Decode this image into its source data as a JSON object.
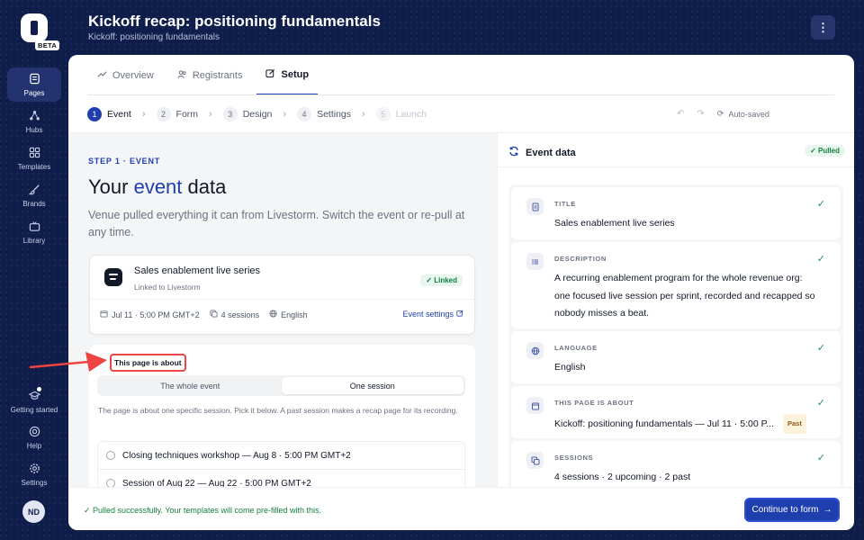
{
  "brand": {
    "beta": "BETA"
  },
  "rail": {
    "items": [
      {
        "label": "Pages",
        "icon": "pages-icon"
      },
      {
        "label": "Hubs",
        "icon": "hubs-icon"
      },
      {
        "label": "Templates",
        "icon": "templates-icon"
      },
      {
        "label": "Brands",
        "icon": "brush-icon"
      },
      {
        "label": "Library",
        "icon": "tv-icon"
      }
    ],
    "bottom": [
      {
        "label": "Getting started",
        "icon": "graduation-cap-icon"
      },
      {
        "label": "Help",
        "icon": "lifebuoy-icon"
      },
      {
        "label": "Settings",
        "icon": "gear-icon"
      }
    ],
    "avatar": "ND"
  },
  "header": {
    "title": "Kickoff recap: positioning fundamentals",
    "subtitle": "Kickoff: positioning fundamentals"
  },
  "tabs": [
    "Overview",
    "Registrants",
    "Setup"
  ],
  "steps": [
    {
      "num": "1",
      "label": "Event"
    },
    {
      "num": "2",
      "label": "Form"
    },
    {
      "num": "3",
      "label": "Design"
    },
    {
      "num": "4",
      "label": "Settings"
    },
    {
      "num": "5",
      "label": "Launch"
    }
  ],
  "autosaved": "Auto-saved",
  "left": {
    "eyebrow": "STEP 1 · EVENT",
    "headline_pre": "Your ",
    "headline_accent": "event",
    "headline_post": " data",
    "lead": "Venue pulled everything it can from Livestorm. Switch the event or re-pull at any time.",
    "event": {
      "name": "Sales enablement live series",
      "sub": "Linked to Livestorm",
      "badge": "✓ Linked",
      "date": "Jul 11 · 5:00 PM GMT+2",
      "sessions": "4 sessions",
      "language": "English",
      "settings": "Event settings"
    },
    "about": {
      "label": "This page is about",
      "options": [
        "The whole event",
        "One session"
      ],
      "help": "The page is about one specific session. Pick it below. A past session makes a recap page for its recording.",
      "sessions": [
        "Closing techniques workshop — Aug 8 · 5:00 PM GMT+2",
        "Session of Aug 22 — Aug 22 · 5:00 PM GMT+2"
      ]
    }
  },
  "right": {
    "title": "Event data",
    "badge": "✓ Pulled",
    "fields": [
      {
        "label": "TITLE",
        "value": "Sales enablement live series",
        "icon": "document-icon"
      },
      {
        "label": "DESCRIPTION",
        "value": "A recurring enablement program for the whole revenue org: one focused live session per sprint, recorded and recapped so nobody misses a beat.",
        "icon": "list-icon"
      },
      {
        "label": "LANGUAGE",
        "value": "English",
        "icon": "globe-icon"
      },
      {
        "label": "THIS PAGE IS ABOUT",
        "value": "Kickoff: positioning fundamentals — Jul 11 · 5:00 P...",
        "badge": "Past",
        "icon": "calendar-icon"
      },
      {
        "label": "SESSIONS",
        "value": "4 sessions · 2 upcoming · 2 past",
        "icon": "copy-icon"
      }
    ]
  },
  "footer": {
    "message": "✓ Pulled successfully. Your templates will come pre-filled with this.",
    "continue": "Continue to form"
  },
  "colors": {
    "accent": "#1f3fae",
    "success": "#15803d",
    "annotation": "#ef4444",
    "background": "#0f1d4a"
  }
}
